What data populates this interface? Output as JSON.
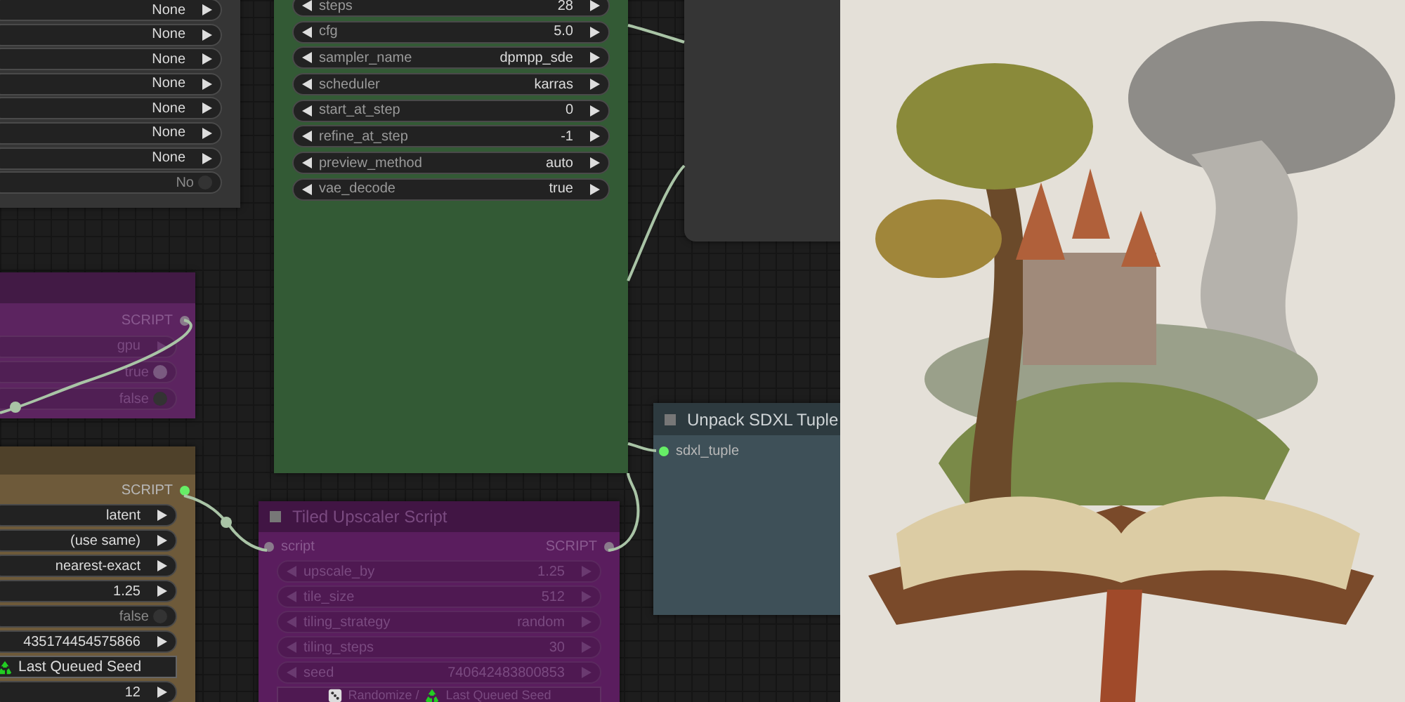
{
  "canvas": {
    "nodes": [
      {
        "kind": "node",
        "color": "#353535",
        "widgets": [
          {
            "kind": "combo",
            "value": "None"
          },
          {
            "kind": "combo",
            "value": "None"
          },
          {
            "kind": "combo",
            "value": "None"
          },
          {
            "kind": "combo",
            "value": "None"
          },
          {
            "kind": "combo",
            "value": "None"
          },
          {
            "kind": "combo",
            "value": "None"
          },
          {
            "kind": "combo",
            "value": "None"
          },
          {
            "kind": "toggle",
            "value": "No",
            "on": false
          }
        ]
      },
      {
        "kind": "node",
        "color": "#335a35",
        "widgets": [
          {
            "kind": "combo",
            "label": "steps",
            "value": "28"
          },
          {
            "kind": "combo",
            "label": "cfg",
            "value": "5.0"
          },
          {
            "kind": "combo",
            "label": "sampler_name",
            "value": "dpmpp_sde"
          },
          {
            "kind": "combo",
            "label": "scheduler",
            "value": "karras"
          },
          {
            "kind": "combo",
            "label": "start_at_step",
            "value": "0"
          },
          {
            "kind": "combo",
            "label": "refine_at_step",
            "value": "-1"
          },
          {
            "kind": "combo",
            "label": "preview_method",
            "value": "auto"
          },
          {
            "kind": "combo",
            "label": "vae_decode",
            "value": "true"
          }
        ]
      },
      {
        "kind": "node",
        "color": "#353535"
      },
      {
        "kind": "node",
        "color": "#5c2460",
        "dimmed": true,
        "outputs": [
          {
            "name": "SCRIPT",
            "color": "#8a7a8c"
          }
        ],
        "widgets": [
          {
            "kind": "combo",
            "value": "gpu"
          },
          {
            "kind": "toggle",
            "value": "true",
            "on": true
          },
          {
            "kind": "toggle",
            "value": "false",
            "on": false
          }
        ]
      },
      {
        "kind": "node",
        "color": "#6e5a3a",
        "outputs": [
          {
            "name": "SCRIPT",
            "color": "#66ee66"
          }
        ],
        "widgets": [
          {
            "kind": "combo",
            "value": "latent"
          },
          {
            "kind": "combo",
            "value": "(use same)"
          },
          {
            "kind": "combo",
            "value": "nearest-exact"
          },
          {
            "kind": "combo",
            "value": "1.25"
          },
          {
            "kind": "toggle",
            "value": "false",
            "on": false
          },
          {
            "kind": "combo",
            "value": "435174454575866"
          },
          {
            "kind": "button",
            "parts": [
              "Last Queued Seed"
            ]
          },
          {
            "kind": "combo",
            "value": "12"
          }
        ]
      },
      {
        "kind": "node",
        "color": "#5a1d5e",
        "dimmed": true,
        "title": "Tiled Upscaler Script",
        "inputs": [
          {
            "name": "script",
            "color": "#8a7a8c"
          }
        ],
        "outputs": [
          {
            "name": "SCRIPT",
            "color": "#8a7a8c"
          }
        ],
        "widgets": [
          {
            "kind": "combo",
            "label": "upscale_by",
            "value": "1.25"
          },
          {
            "kind": "combo",
            "label": "tile_size",
            "value": "512"
          },
          {
            "kind": "combo",
            "label": "tiling_strategy",
            "value": "random"
          },
          {
            "kind": "combo",
            "label": "tiling_steps",
            "value": "30"
          },
          {
            "kind": "combo",
            "label": "seed",
            "value": "740642483800853"
          },
          {
            "kind": "button",
            "parts": [
              "Randomize /",
              "Last Queued Seed"
            ]
          }
        ]
      },
      {
        "kind": "node",
        "color": "#3e5058",
        "title": "Unpack SDXL Tuple",
        "inputs": [
          {
            "name": "sdxl_tuple",
            "color": "#66ee66"
          }
        ]
      }
    ]
  }
}
